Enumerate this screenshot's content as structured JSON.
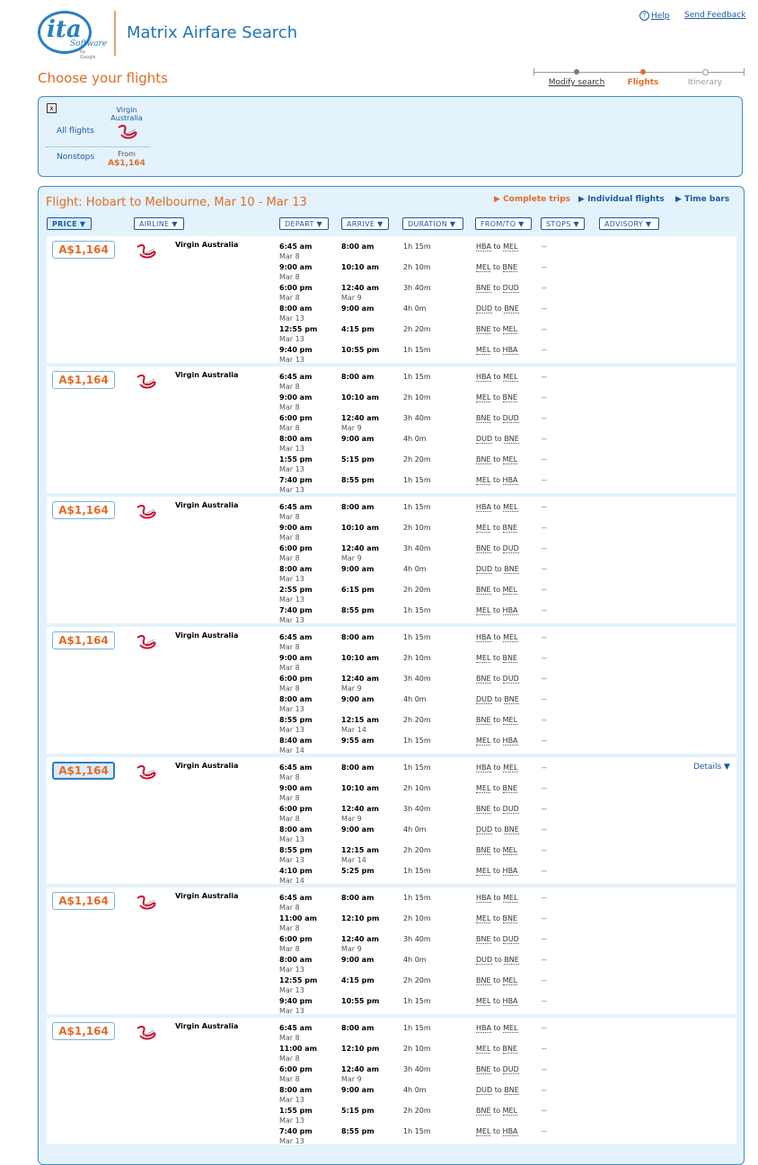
{
  "header": {
    "logo": {
      "mark": "ita",
      "sub": "Software",
      "google": "by Google"
    },
    "app_title": "Matrix Airfare Search",
    "help": "Help",
    "feedback": "Send Feedback",
    "page_heading": "Choose your flights",
    "steps": [
      {
        "label": "Modify search",
        "state": "done"
      },
      {
        "label": "Flights",
        "state": "current"
      },
      {
        "label": "Itinerary",
        "state": "todo"
      }
    ]
  },
  "filter": {
    "close": "x",
    "all_flights": "All flights",
    "nonstops": "Nonstops",
    "airline_line1": "Virgin",
    "airline_line2": "Australia",
    "from_label": "From",
    "from_price": "A$1,164"
  },
  "results": {
    "title": "Flight: Hobart to Melbourne, Mar 10 - Mar 13",
    "views": [
      "Complete trips",
      "Individual flights",
      "Time bars"
    ],
    "columns": [
      "PRICE ▼",
      "AIRLINE ▼",
      "DEPART ▼",
      "ARRIVE ▼",
      "DURATION ▼",
      "FROM/TO ▼",
      "STOPS ▼",
      "ADVISORY ▼"
    ],
    "details_label": "Details ▼",
    "to_word": "to",
    "trips": [
      {
        "price": "A$1,164",
        "airline": "Virgin Australia",
        "segments": [
          {
            "dep": "6:45 am",
            "dep_date": "Mar 8",
            "arr": "8:00 am",
            "arr_date": "",
            "dur": "1h 15m",
            "from": "HBA",
            "to": "MEL",
            "stops": "--"
          },
          {
            "dep": "9:00 am",
            "dep_date": "Mar 8",
            "arr": "10:10 am",
            "arr_date": "",
            "dur": "2h 10m",
            "from": "MEL",
            "to": "BNE",
            "stops": "--"
          },
          {
            "dep": "6:00 pm",
            "dep_date": "Mar 8",
            "arr": "12:40 am",
            "arr_date": "Mar 9",
            "dur": "3h 40m",
            "from": "BNE",
            "to": "DUD",
            "stops": "--"
          },
          {
            "dep": "8:00 am",
            "dep_date": "Mar 13",
            "arr": "9:00 am",
            "arr_date": "",
            "dur": "4h 0m",
            "from": "DUD",
            "to": "BNE",
            "stops": "--"
          },
          {
            "dep": "12:55 pm",
            "dep_date": "Mar 13",
            "arr": "4:15 pm",
            "arr_date": "",
            "dur": "2h 20m",
            "from": "BNE",
            "to": "MEL",
            "stops": "--"
          },
          {
            "dep": "9:40 pm",
            "dep_date": "Mar 13",
            "arr": "10:55 pm",
            "arr_date": "",
            "dur": "1h 15m",
            "from": "MEL",
            "to": "HBA",
            "stops": "--"
          }
        ]
      },
      {
        "price": "A$1,164",
        "airline": "Virgin Australia",
        "segments": [
          {
            "dep": "6:45 am",
            "dep_date": "Mar 8",
            "arr": "8:00 am",
            "arr_date": "",
            "dur": "1h 15m",
            "from": "HBA",
            "to": "MEL",
            "stops": "--"
          },
          {
            "dep": "9:00 am",
            "dep_date": "Mar 8",
            "arr": "10:10 am",
            "arr_date": "",
            "dur": "2h 10m",
            "from": "MEL",
            "to": "BNE",
            "stops": "--"
          },
          {
            "dep": "6:00 pm",
            "dep_date": "Mar 8",
            "arr": "12:40 am",
            "arr_date": "Mar 9",
            "dur": "3h 40m",
            "from": "BNE",
            "to": "DUD",
            "stops": "--"
          },
          {
            "dep": "8:00 am",
            "dep_date": "Mar 13",
            "arr": "9:00 am",
            "arr_date": "",
            "dur": "4h 0m",
            "from": "DUD",
            "to": "BNE",
            "stops": "--"
          },
          {
            "dep": "1:55 pm",
            "dep_date": "Mar 13",
            "arr": "5:15 pm",
            "arr_date": "",
            "dur": "2h 20m",
            "from": "BNE",
            "to": "MEL",
            "stops": "--"
          },
          {
            "dep": "7:40 pm",
            "dep_date": "Mar 13",
            "arr": "8:55 pm",
            "arr_date": "",
            "dur": "1h 15m",
            "from": "MEL",
            "to": "HBA",
            "stops": "--"
          }
        ]
      },
      {
        "price": "A$1,164",
        "airline": "Virgin Australia",
        "segments": [
          {
            "dep": "6:45 am",
            "dep_date": "Mar 8",
            "arr": "8:00 am",
            "arr_date": "",
            "dur": "1h 15m",
            "from": "HBA",
            "to": "MEL",
            "stops": "--"
          },
          {
            "dep": "9:00 am",
            "dep_date": "Mar 8",
            "arr": "10:10 am",
            "arr_date": "",
            "dur": "2h 10m",
            "from": "MEL",
            "to": "BNE",
            "stops": "--"
          },
          {
            "dep": "6:00 pm",
            "dep_date": "Mar 8",
            "arr": "12:40 am",
            "arr_date": "Mar 9",
            "dur": "3h 40m",
            "from": "BNE",
            "to": "DUD",
            "stops": "--"
          },
          {
            "dep": "8:00 am",
            "dep_date": "Mar 13",
            "arr": "9:00 am",
            "arr_date": "",
            "dur": "4h 0m",
            "from": "DUD",
            "to": "BNE",
            "stops": "--"
          },
          {
            "dep": "2:55 pm",
            "dep_date": "Mar 13",
            "arr": "6:15 pm",
            "arr_date": "",
            "dur": "2h 20m",
            "from": "BNE",
            "to": "MEL",
            "stops": "--"
          },
          {
            "dep": "7:40 pm",
            "dep_date": "Mar 13",
            "arr": "8:55 pm",
            "arr_date": "",
            "dur": "1h 15m",
            "from": "MEL",
            "to": "HBA",
            "stops": "--"
          }
        ]
      },
      {
        "price": "A$1,164",
        "airline": "Virgin Australia",
        "segments": [
          {
            "dep": "6:45 am",
            "dep_date": "Mar 8",
            "arr": "8:00 am",
            "arr_date": "",
            "dur": "1h 15m",
            "from": "HBA",
            "to": "MEL",
            "stops": "--"
          },
          {
            "dep": "9:00 am",
            "dep_date": "Mar 8",
            "arr": "10:10 am",
            "arr_date": "",
            "dur": "2h 10m",
            "from": "MEL",
            "to": "BNE",
            "stops": "--"
          },
          {
            "dep": "6:00 pm",
            "dep_date": "Mar 8",
            "arr": "12:40 am",
            "arr_date": "Mar 9",
            "dur": "3h 40m",
            "from": "BNE",
            "to": "DUD",
            "stops": "--"
          },
          {
            "dep": "8:00 am",
            "dep_date": "Mar 13",
            "arr": "9:00 am",
            "arr_date": "",
            "dur": "4h 0m",
            "from": "DUD",
            "to": "BNE",
            "stops": "--"
          },
          {
            "dep": "8:55 pm",
            "dep_date": "Mar 13",
            "arr": "12:15 am",
            "arr_date": "Mar 14",
            "dur": "2h 20m",
            "from": "BNE",
            "to": "MEL",
            "stops": "--"
          },
          {
            "dep": "8:40 am",
            "dep_date": "Mar 14",
            "arr": "9:55 am",
            "arr_date": "",
            "dur": "1h 15m",
            "from": "MEL",
            "to": "HBA",
            "stops": "--"
          }
        ]
      },
      {
        "price": "A$1,164",
        "airline": "Virgin Australia",
        "selected": true,
        "segments": [
          {
            "dep": "6:45 am",
            "dep_date": "Mar 8",
            "arr": "8:00 am",
            "arr_date": "",
            "dur": "1h 15m",
            "from": "HBA",
            "to": "MEL",
            "stops": "--"
          },
          {
            "dep": "9:00 am",
            "dep_date": "Mar 8",
            "arr": "10:10 am",
            "arr_date": "",
            "dur": "2h 10m",
            "from": "MEL",
            "to": "BNE",
            "stops": "--"
          },
          {
            "dep": "6:00 pm",
            "dep_date": "Mar 8",
            "arr": "12:40 am",
            "arr_date": "Mar 9",
            "dur": "3h 40m",
            "from": "BNE",
            "to": "DUD",
            "stops": "--"
          },
          {
            "dep": "8:00 am",
            "dep_date": "Mar 13",
            "arr": "9:00 am",
            "arr_date": "",
            "dur": "4h 0m",
            "from": "DUD",
            "to": "BNE",
            "stops": "--"
          },
          {
            "dep": "8:55 pm",
            "dep_date": "Mar 13",
            "arr": "12:15 am",
            "arr_date": "Mar 14",
            "dur": "2h 20m",
            "from": "BNE",
            "to": "MEL",
            "stops": "--"
          },
          {
            "dep": "4:10 pm",
            "dep_date": "Mar 14",
            "arr": "5:25 pm",
            "arr_date": "",
            "dur": "1h 15m",
            "from": "MEL",
            "to": "HBA",
            "stops": "--"
          }
        ]
      },
      {
        "price": "A$1,164",
        "airline": "Virgin Australia",
        "segments": [
          {
            "dep": "6:45 am",
            "dep_date": "Mar 8",
            "arr": "8:00 am",
            "arr_date": "",
            "dur": "1h 15m",
            "from": "HBA",
            "to": "MEL",
            "stops": "--"
          },
          {
            "dep": "11:00 am",
            "dep_date": "Mar 8",
            "arr": "12:10 pm",
            "arr_date": "",
            "dur": "2h 10m",
            "from": "MEL",
            "to": "BNE",
            "stops": "--"
          },
          {
            "dep": "6:00 pm",
            "dep_date": "Mar 8",
            "arr": "12:40 am",
            "arr_date": "Mar 9",
            "dur": "3h 40m",
            "from": "BNE",
            "to": "DUD",
            "stops": "--"
          },
          {
            "dep": "8:00 am",
            "dep_date": "Mar 13",
            "arr": "9:00 am",
            "arr_date": "",
            "dur": "4h 0m",
            "from": "DUD",
            "to": "BNE",
            "stops": "--"
          },
          {
            "dep": "12:55 pm",
            "dep_date": "Mar 13",
            "arr": "4:15 pm",
            "arr_date": "",
            "dur": "2h 20m",
            "from": "BNE",
            "to": "MEL",
            "stops": "--"
          },
          {
            "dep": "9:40 pm",
            "dep_date": "Mar 13",
            "arr": "10:55 pm",
            "arr_date": "",
            "dur": "1h 15m",
            "from": "MEL",
            "to": "HBA",
            "stops": "--"
          }
        ]
      },
      {
        "price": "A$1,164",
        "airline": "Virgin Australia",
        "segments": [
          {
            "dep": "6:45 am",
            "dep_date": "Mar 8",
            "arr": "8:00 am",
            "arr_date": "",
            "dur": "1h 15m",
            "from": "HBA",
            "to": "MEL",
            "stops": "--"
          },
          {
            "dep": "11:00 am",
            "dep_date": "Mar 8",
            "arr": "12:10 pm",
            "arr_date": "",
            "dur": "2h 10m",
            "from": "MEL",
            "to": "BNE",
            "stops": "--"
          },
          {
            "dep": "6:00 pm",
            "dep_date": "Mar 8",
            "arr": "12:40 am",
            "arr_date": "Mar 9",
            "dur": "3h 40m",
            "from": "BNE",
            "to": "DUD",
            "stops": "--"
          },
          {
            "dep": "8:00 am",
            "dep_date": "Mar 13",
            "arr": "9:00 am",
            "arr_date": "",
            "dur": "4h 0m",
            "from": "DUD",
            "to": "BNE",
            "stops": "--"
          },
          {
            "dep": "1:55 pm",
            "dep_date": "Mar 13",
            "arr": "5:15 pm",
            "arr_date": "",
            "dur": "2h 20m",
            "from": "BNE",
            "to": "MEL",
            "stops": "--"
          },
          {
            "dep": "7:40 pm",
            "dep_date": "Mar 13",
            "arr": "8:55 pm",
            "arr_date": "",
            "dur": "1h 15m",
            "from": "MEL",
            "to": "HBA",
            "stops": "--"
          }
        ]
      }
    ]
  },
  "colors": {
    "accent_orange": "#e06c2a",
    "link_blue": "#1a5aa0",
    "panel_bg": "#e3f2fb",
    "panel_border": "#3c8dc5"
  }
}
